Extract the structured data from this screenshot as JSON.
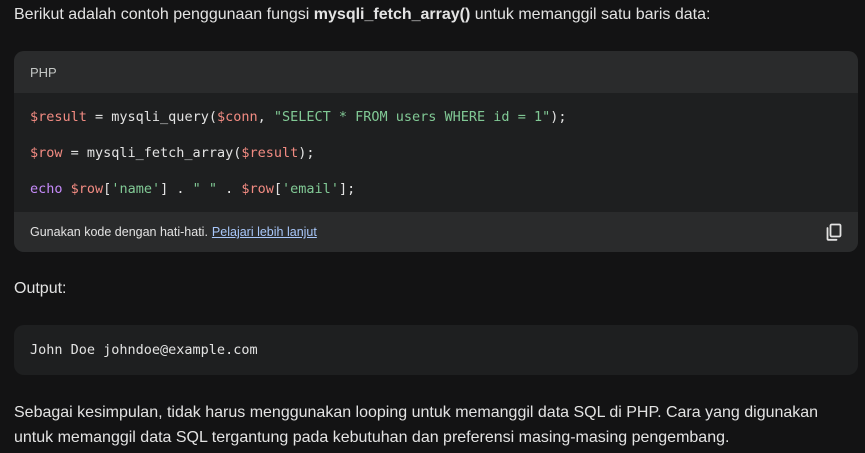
{
  "intro": {
    "before": "Berikut adalah contoh penggunaan fungsi ",
    "func": "mysqli_fetch_array()",
    "after": " untuk memanggil satu baris data:"
  },
  "code_block": {
    "language": "PHP",
    "lines": {
      "l1": {
        "v1": "$result",
        "t1": " = mysqli_query(",
        "v2": "$conn",
        "t2": ", ",
        "s1": "\"SELECT * FROM users WHERE id = 1\"",
        "t3": ");"
      },
      "l2": {
        "v1": "$row",
        "t1": " = mysqli_fetch_array(",
        "v2": "$result",
        "t2": ");"
      },
      "l3": {
        "k1": "echo",
        "t0": " ",
        "v1": "$row",
        "t1": "[",
        "s1": "'name'",
        "t2": "] . ",
        "s2": "\" \"",
        "t3": " . ",
        "v2": "$row",
        "t4": "[",
        "s3": "'email'",
        "t5": "];"
      }
    },
    "footer_text": "Gunakan kode dengan hati-hati.",
    "footer_link": "Pelajari lebih lanjut",
    "copy_icon": "copy-icon"
  },
  "output_label": "Output:",
  "output_value": "John Doe johndoe@example.com",
  "conclusion": "Sebagai kesimpulan, tidak harus menggunakan looping untuk memanggil data SQL di PHP. Cara yang digunakan untuk memanggil data SQL tergantung pada kebutuhan dan preferensi masing-masing pengembang.",
  "colors": {
    "background": "#131314",
    "card": "#1e1f20",
    "card_header": "#2a2b2c",
    "variable": "#f28b82",
    "string": "#81c995",
    "keyword": "#c58af9",
    "link": "#a8c7fa"
  }
}
